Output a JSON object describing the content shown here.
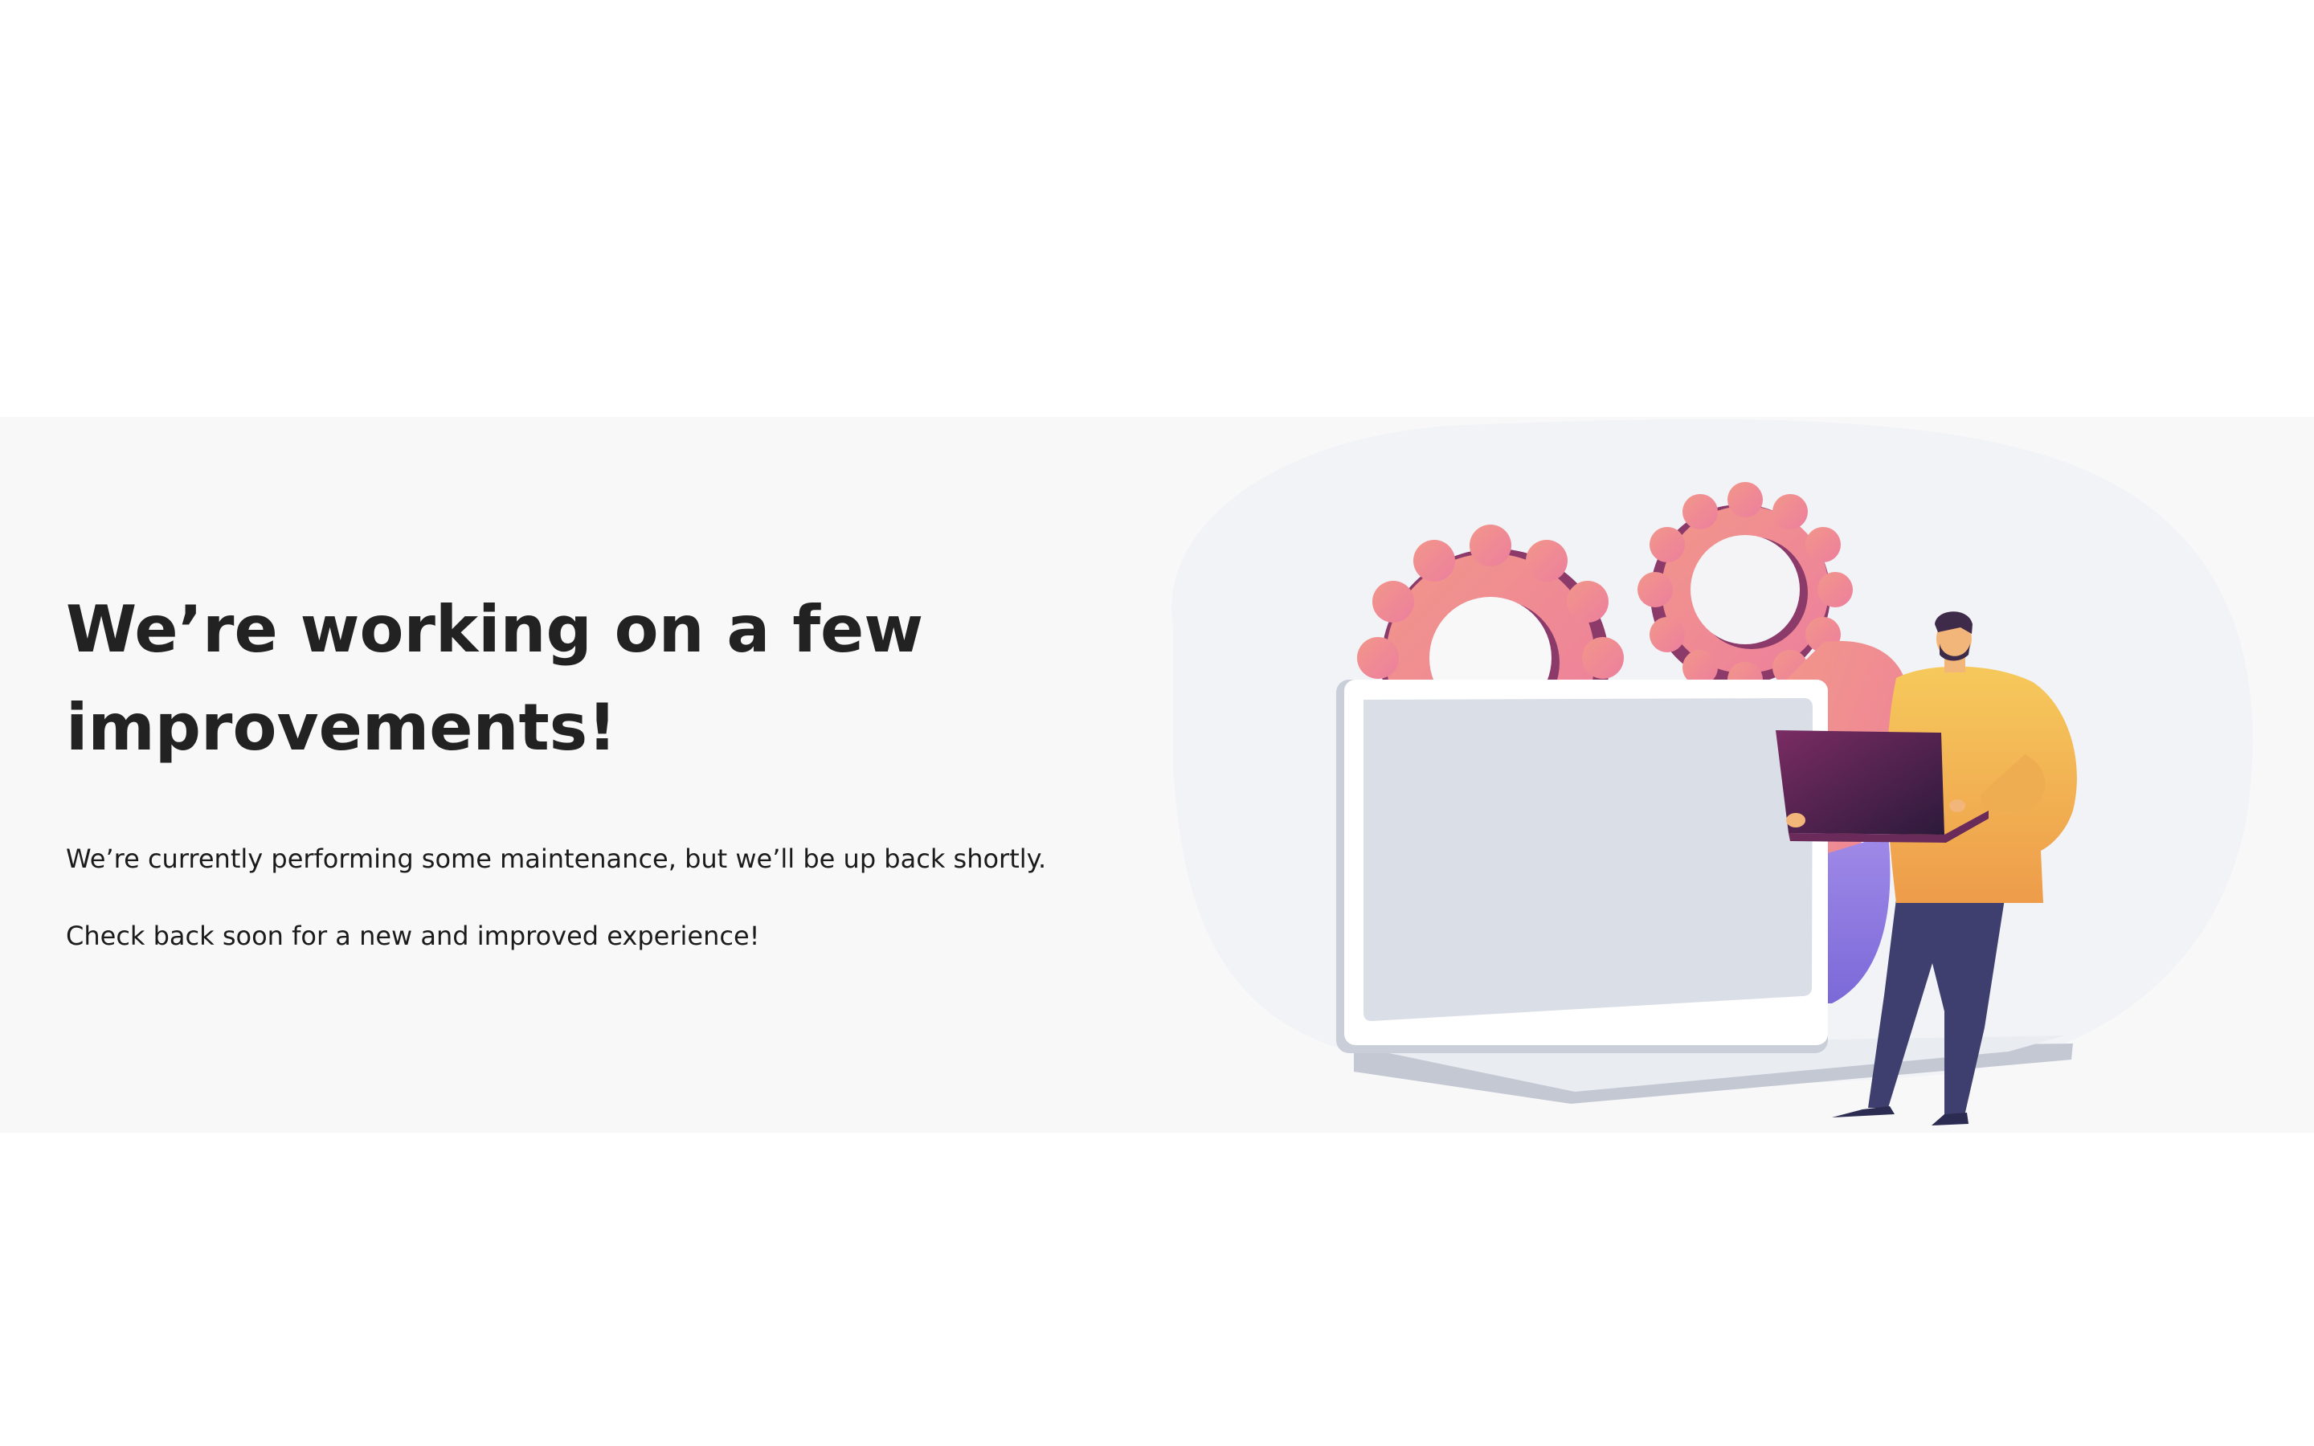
{
  "hero": {
    "headline": "We’re working on a few improvements!",
    "message_line_1": "We’re currently performing some maintenance, but we’ll be up back shortly.",
    "message_line_2": "Check back soon for a new and improved experience!"
  },
  "illustration": {
    "icons": [
      "gear-icon",
      "gear-icon",
      "laptop-icon",
      "person-icon"
    ]
  },
  "colors": {
    "page_background": "#ffffff",
    "band_background": "#f8f8f9",
    "heading_text": "#222222",
    "body_text": "#1b1b1b",
    "gear_pink": "#f0868d",
    "gear_shadow": "#8b3a6a",
    "shirt_yellow": "#f5c05a",
    "pants_navy": "#3e3f6e",
    "laptop_purple": "#5a2350"
  }
}
